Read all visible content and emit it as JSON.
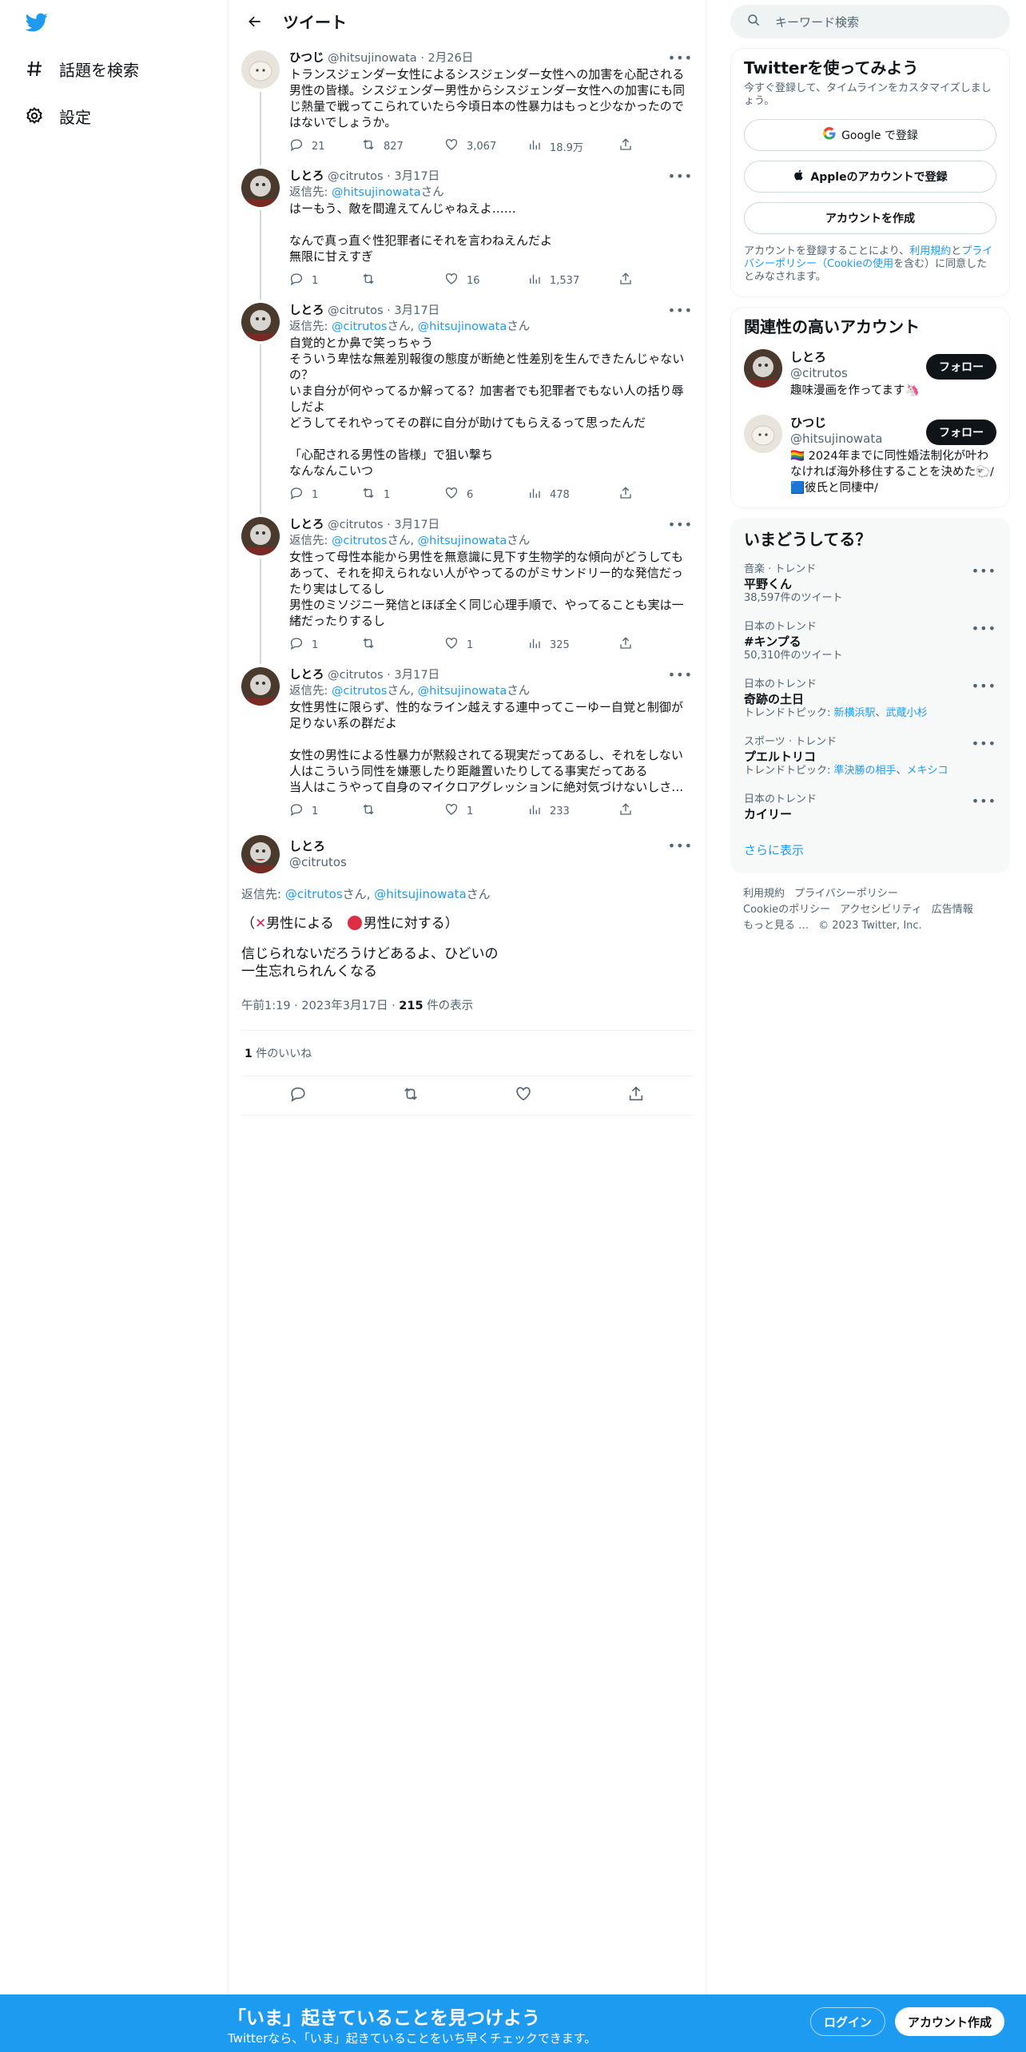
{
  "nav": {
    "explore_label": "話題を検索",
    "settings_label": "設定"
  },
  "header": {
    "title": "ツイート"
  },
  "tweets": [
    {
      "name": "ひつじ",
      "handle": "@hitsujinowata",
      "date": "· 2月26日",
      "reply_prefix": "",
      "reply_to": [],
      "text": "トランスジェンダー女性によるシスジェンダー女性への加害を心配される男性の皆様。シスジェンダー男性からシスジェンダー女性への加害にも同じ熱量で戦ってこられていたら今頃日本の性暴力はもっと少なかったのではないでしょうか。",
      "replies": "21",
      "retweets": "827",
      "likes": "3,067",
      "views": "18.9万"
    },
    {
      "name": "しとろ",
      "handle": "@citrutos",
      "date": "· 3月17日",
      "reply_prefix": "返信先: ",
      "reply_to": [
        "@hitsujinowata"
      ],
      "reply_suffix": "さん",
      "text": "はーもう、敵を間違えてんじゃねえよ……\n\nなんで真っ直ぐ性犯罪者にそれを言わねえんだよ\n無限に甘えすぎ",
      "replies": "1",
      "retweets": "",
      "likes": "16",
      "views": "1,537"
    },
    {
      "name": "しとろ",
      "handle": "@citrutos",
      "date": "· 3月17日",
      "reply_prefix": "返信先: ",
      "reply_to": [
        "@citrutos",
        "@hitsujinowata"
      ],
      "reply_suffix": "さん",
      "text": "自覚的とか鼻で笑っちゃう\nそういう卑怯な無差別報復の態度が断絶と性差別を生んできたんじゃないの？\nいま自分が何やってるか解ってる？加害者でも犯罪者でもない人の括り辱しだよ\nどうしてそれやってその群に自分が助けてもらえるって思ったんだ\n\n「心配される男性の皆様」で狙い撃ち\nなんなんこいつ",
      "replies": "1",
      "retweets": "1",
      "likes": "6",
      "views": "478"
    },
    {
      "name": "しとろ",
      "handle": "@citrutos",
      "date": "· 3月17日",
      "reply_prefix": "返信先: ",
      "reply_to": [
        "@citrutos",
        "@hitsujinowata"
      ],
      "reply_suffix": "さん",
      "text": "女性って母性本能から男性を無意識に見下す生物学的な傾向がどうしてもあって、それを抑えられない人がやってるのがミサンドリー的な発信だったり実はしてるし\n男性のミソジニー発信とほぼ全く同じ心理手順で、やってることも実は一緒だったりするし",
      "replies": "1",
      "retweets": "",
      "likes": "1",
      "views": "325"
    },
    {
      "name": "しとろ",
      "handle": "@citrutos",
      "date": "· 3月17日",
      "reply_prefix": "返信先: ",
      "reply_to": [
        "@citrutos",
        "@hitsujinowata"
      ],
      "reply_suffix": "さん",
      "text": "女性男性に限らず、性的なライン越えする連中ってこーゆー自覚と制御が足りない系の群だよ\n\n女性の男性による性暴力が黙殺されてる現実だってあるし、それをしない人はこういう同性を嫌悪したり距離置いたりしてる事実だってある\n当人はこうやって自身のマイクロアグレッションに絶対気づけないしさ…",
      "replies": "1",
      "retweets": "",
      "likes": "1",
      "views": "233"
    }
  ],
  "focus": {
    "name": "しとろ",
    "handle": "@citrutos",
    "reply_prefix": "返信先: ",
    "reply_to": [
      "@citrutos",
      "@hitsujinowata"
    ],
    "reply_suffix": "さん",
    "line1_open": "（",
    "line1_a": "男性による　",
    "line1_b": "男性に対する）",
    "text": "信じられないだろうけどあるよ、ひどいの\n一生忘れられんくなる",
    "time": "午前1:19 · 2023年3月17日 · ",
    "views_count": "215",
    "views_label": " 件の表示",
    "likes_count": "1",
    "likes_label": " 件のいいね"
  },
  "right": {
    "search_placeholder": "キーワード検索",
    "signup": {
      "title": "Twitterを使ってみよう",
      "sub": "今すぐ登録して、タイムラインをカスタマイズしましょう。",
      "google": "Google で登録",
      "apple": "Appleのアカウントで登録",
      "create": "アカウントを作成",
      "legal_1": "アカウントを登録することにより、",
      "legal_terms": "利用規約",
      "legal_2": "と",
      "legal_privacy": "プライバシーポリシー",
      "legal_cookie": "（Cookieの使用",
      "legal_3": "を含む）に同意したとみなされます。"
    },
    "related": {
      "title": "関連性の高いアカウント",
      "accounts": [
        {
          "name": "しとろ",
          "handle": "@citrutos",
          "bio": "趣味漫画を作ってます🦄",
          "follow": "フォロー"
        },
        {
          "name": "ひつじ",
          "handle": "@hitsujinowata",
          "bio": "🏳️‍🌈 2024年までに同性婚法制化が叶わなければ海外移住することを決めた🐑/🟦彼氏と同棲中/",
          "follow": "フォロー"
        }
      ]
    },
    "trends": {
      "title": "いまどうしてる？",
      "items": [
        {
          "cat": "音楽 · トレンド",
          "name": "平野くん",
          "sub": "38,597件のツイート",
          "topics_label": "",
          "topics": []
        },
        {
          "cat": "日本のトレンド",
          "name": "#キンプる",
          "sub": "50,310件のツイート",
          "topics_label": "",
          "topics": []
        },
        {
          "cat": "日本のトレンド",
          "name": "奇跡の土日",
          "sub": "",
          "topics_label": "トレンドトピック: ",
          "topics": [
            "新横浜駅",
            "武蔵小杉"
          ]
        },
        {
          "cat": "スポーツ · トレンド",
          "name": "プエルトリコ",
          "sub": "",
          "topics_label": "トレンドトピック: ",
          "topics": [
            "準決勝の相手",
            "メキシコ"
          ]
        },
        {
          "cat": "日本のトレンド",
          "name": "カイリー",
          "sub": "",
          "topics_label": "",
          "topics": []
        }
      ],
      "show_more": "さらに表示"
    },
    "footer": {
      "terms": "利用規約",
      "privacy": "プライバシーポリシー",
      "cookie": "Cookieのポリシー",
      "accessibility": "アクセシビリティ",
      "ads": "広告情報",
      "more": "もっと見る …",
      "copyright": "© 2023 Twitter, Inc."
    }
  },
  "bottom": {
    "title": "「いま」起きていることを見つけよう",
    "sub": "Twitterなら、「いま」起きていることをいち早くチェックできます。",
    "login": "ログイン",
    "signup": "アカウント作成"
  }
}
